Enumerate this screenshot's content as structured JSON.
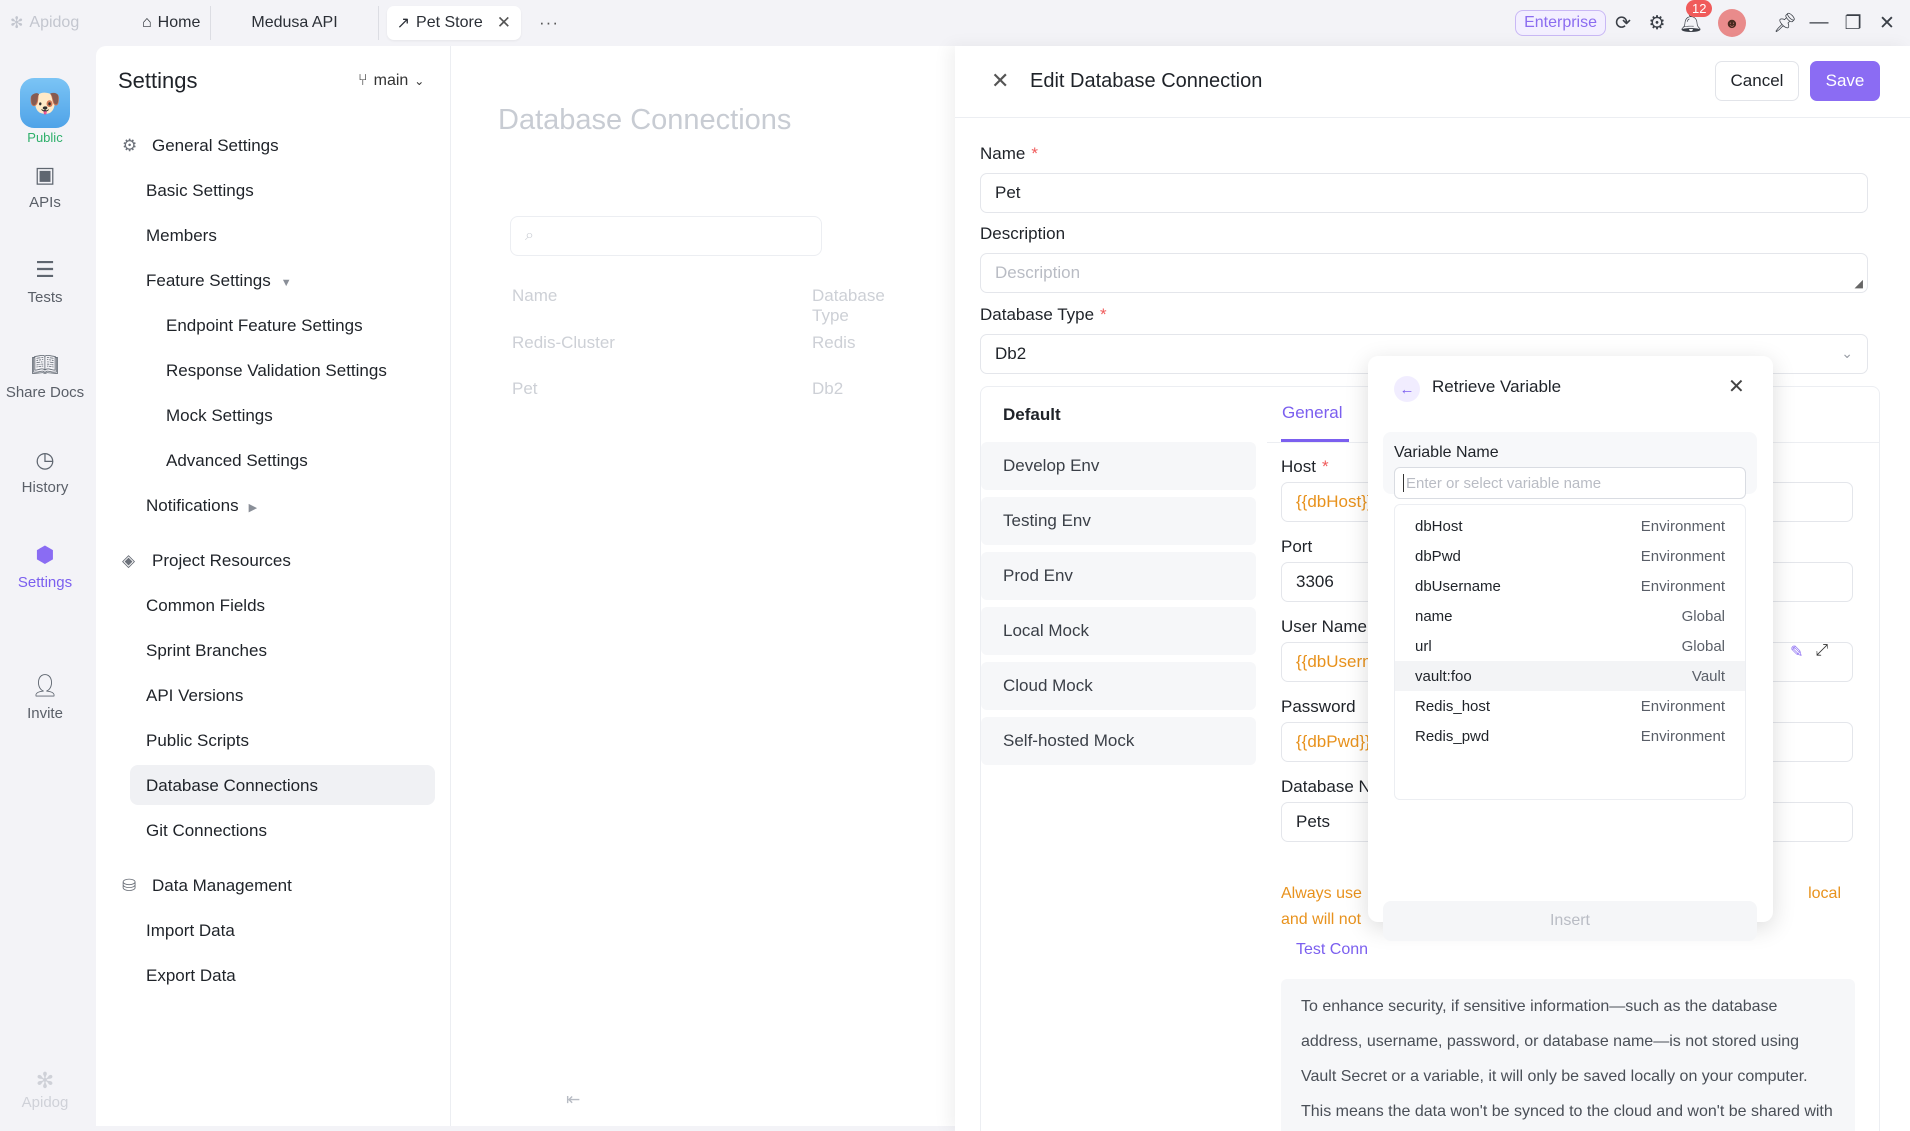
{
  "titlebar": {
    "app_name": "Apidog",
    "tabs": [
      {
        "label": "Home",
        "icon": "home-icon"
      },
      {
        "label": "Medusa API"
      },
      {
        "label": "Pet Store",
        "icon": "external-link-icon"
      }
    ],
    "more": "···",
    "enterprise": "Enterprise",
    "notification_count": "12"
  },
  "rail": {
    "project_badge": "Public",
    "items": [
      {
        "label": "APIs",
        "icon": "apis-icon"
      },
      {
        "label": "Tests",
        "icon": "tests-icon"
      },
      {
        "label": "Share Docs",
        "icon": "book-icon"
      },
      {
        "label": "History",
        "icon": "clock-icon"
      },
      {
        "label": "Settings",
        "icon": "settings-icon"
      },
      {
        "label": "Invite",
        "icon": "user-plus-icon"
      }
    ],
    "footer": "Apidog"
  },
  "settings_nav": {
    "title": "Settings",
    "branch": "main",
    "groups": [
      {
        "label": "General Settings",
        "icon": "gear-icon"
      },
      {
        "label": "Project Resources",
        "icon": "layers-icon"
      },
      {
        "label": "Data Management",
        "icon": "database-icon"
      }
    ],
    "items": {
      "basic": "Basic Settings",
      "members": "Members",
      "feature": "Feature Settings",
      "endpoint_feature": "Endpoint Feature Settings",
      "response_validation": "Response Validation Settings",
      "mock": "Mock Settings",
      "advanced": "Advanced Settings",
      "notifications": "Notifications",
      "common_fields": "Common Fields",
      "sprint_branches": "Sprint Branches",
      "api_versions": "API Versions",
      "public_scripts": "Public Scripts",
      "database_connections": "Database Connections",
      "git_connections": "Git Connections",
      "import_data": "Import Data",
      "export_data": "Export Data"
    }
  },
  "db_page": {
    "title": "Database Connections",
    "columns": [
      "Name",
      "Database Type"
    ],
    "rows": [
      {
        "name": "Redis-Cluster",
        "type": "Redis"
      },
      {
        "name": "Pet",
        "type": "Db2"
      }
    ]
  },
  "drawer": {
    "title": "Edit Database Connection",
    "cancel": "Cancel",
    "save": "Save",
    "name_label": "Name",
    "name_value": "Pet",
    "desc_label": "Description",
    "desc_placeholder": "Description",
    "type_label": "Database Type",
    "type_value": "Db2",
    "env_head": "Default",
    "envs": [
      "Develop Env",
      "Testing Env",
      "Prod Env",
      "Local Mock",
      "Cloud Mock",
      "Self-hosted Mock"
    ],
    "tab_general": "General",
    "tab_second": "S",
    "host_label": "Host",
    "host_value": "{{dbHost}}",
    "port_label": "Port",
    "port_value": "3306",
    "user_label": "User Name",
    "user_value": "{{dbUsern",
    "password_label": "Password",
    "password_value": "{{dbPwd}}",
    "dbname_label": "Database Na",
    "dbname_value": "Pets",
    "warn_1": "Always use",
    "warn_1b": "local",
    "warn_2": "and will not",
    "test_connection": "Test Conn",
    "info": "To enhance security, if sensitive information—such as the database address, username, password, or database name—is not stored using Vault Secret or a variable, it will only be saved locally on your computer. This means the data won't be synced to the cloud and won't be shared with other team members. Each member will need to"
  },
  "popup": {
    "title": "Retrieve Variable",
    "label": "Variable Name",
    "placeholder": "Enter or select variable name",
    "variables": [
      {
        "name": "dbHost",
        "scope": "Environment"
      },
      {
        "name": "dbPwd",
        "scope": "Environment"
      },
      {
        "name": "dbUsername",
        "scope": "Environment"
      },
      {
        "name": "name",
        "scope": "Global"
      },
      {
        "name": "url",
        "scope": "Global"
      },
      {
        "name": "vault:foo",
        "scope": "Vault"
      },
      {
        "name": "Redis_host",
        "scope": "Environment"
      },
      {
        "name": "Redis_pwd",
        "scope": "Environment"
      }
    ],
    "insert": "Insert"
  }
}
